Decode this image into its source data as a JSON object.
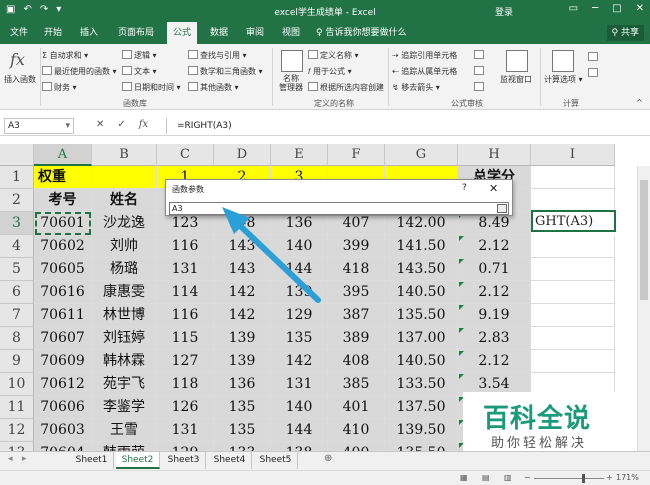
{
  "app": {
    "title": "excel学生成绩单 - Excel",
    "login": "登录",
    "share": "共享",
    "qat_icons": [
      "save-icon",
      "undo-icon",
      "redo-icon",
      "customize-icon"
    ],
    "window_buttons": [
      "minimize-icon",
      "maximize-icon",
      "close-icon"
    ]
  },
  "tabs": [
    {
      "label": "文件"
    },
    {
      "label": "开始"
    },
    {
      "label": "插入"
    },
    {
      "label": "页面布局"
    },
    {
      "label": "公式"
    },
    {
      "label": "数据"
    },
    {
      "label": "审阅"
    },
    {
      "label": "视图"
    }
  ],
  "tell_me": "♀ 告诉我你想要做什么",
  "ribbon": {
    "insert_function": "插入函数",
    "lib": {
      "autosum": "Σ 自动求和 ▾",
      "recent": "最近使用的函数 ▾",
      "financial": "财务 ▾",
      "logical": "逻辑 ▾",
      "text": "文本 ▾",
      "datetime": "日期和时间 ▾",
      "lookup": "查找与引用 ▾",
      "math": "数学和三角函数 ▾",
      "more": "其他函数 ▾",
      "group_label": "函数库"
    },
    "names": {
      "manager": "名称\n管理器",
      "define": "定义名称 ▾",
      "use_in_formula": "用于公式 ▾",
      "create": "根据所选内容创建",
      "group_label": "定义的名称"
    },
    "audit": {
      "trace_precedents": "追踪引用单元格",
      "trace_dependents": "追踪从属单元格",
      "remove_arrows": "移去箭头 ▾",
      "watch": "监视窗口",
      "group_label": "公式审核"
    },
    "calc": {
      "options": "计算选项 ▾",
      "group_label": "计算"
    }
  },
  "formula_bar": {
    "name_box": "A3",
    "formula": "=RIGHT(A3)",
    "icons": [
      "cancel-icon",
      "enter-icon",
      "fx-icon"
    ]
  },
  "columns": [
    "A",
    "B",
    "C",
    "D",
    "E",
    "F",
    "G",
    "H",
    "I"
  ],
  "rows": [
    "1",
    "2",
    "3",
    "4",
    "5",
    "6",
    "7",
    "8",
    "9",
    "10",
    "11",
    "12",
    "13"
  ],
  "row1": {
    "a": "权重",
    "c": "1",
    "d": "2",
    "e": "3",
    "h": "总学分"
  },
  "row2": {
    "a": "考号",
    "b": "姓名",
    "h": "绩点"
  },
  "data_rows": [
    {
      "id": "70601",
      "name": "沙龙逸",
      "c": "123",
      "d": "148",
      "e": "136",
      "f": "407",
      "g": "142.00",
      "h": "8.49"
    },
    {
      "id": "70602",
      "name": "刘帅",
      "c": "116",
      "d": "143",
      "e": "140",
      "f": "399",
      "g": "141.50",
      "h": "2.12"
    },
    {
      "id": "70605",
      "name": "杨璐",
      "c": "131",
      "d": "143",
      "e": "144",
      "f": "418",
      "g": "143.50",
      "h": "0.71"
    },
    {
      "id": "70616",
      "name": "康惠雯",
      "c": "114",
      "d": "142",
      "e": "139",
      "f": "395",
      "g": "140.50",
      "h": "2.12"
    },
    {
      "id": "70611",
      "name": "林世博",
      "c": "116",
      "d": "142",
      "e": "129",
      "f": "387",
      "g": "135.50",
      "h": "9.19"
    },
    {
      "id": "70607",
      "name": "刘钰婷",
      "c": "115",
      "d": "139",
      "e": "135",
      "f": "389",
      "g": "137.00",
      "h": "2.83"
    },
    {
      "id": "70609",
      "name": "韩林霖",
      "c": "127",
      "d": "139",
      "e": "142",
      "f": "408",
      "g": "140.50",
      "h": "2.12"
    },
    {
      "id": "70612",
      "name": "苑宇飞",
      "c": "118",
      "d": "136",
      "e": "131",
      "f": "385",
      "g": "133.50",
      "h": "3.54"
    },
    {
      "id": "70606",
      "name": "李鉴学",
      "c": "126",
      "d": "135",
      "e": "140",
      "f": "401",
      "g": "137.50",
      "h": ""
    },
    {
      "id": "70603",
      "name": "王雪",
      "c": "131",
      "d": "135",
      "e": "144",
      "f": "410",
      "g": "139.50",
      "h": ""
    },
    {
      "id": "70604",
      "name": "韩雨萌",
      "c": "129",
      "d": "133",
      "e": "138",
      "f": "400",
      "g": "135.50",
      "h": ""
    }
  ],
  "edit_cell_text": "GHT(A3)",
  "dialog": {
    "title": "函数参数",
    "help": "?",
    "close": "✕",
    "input_value": "A3"
  },
  "watermark": {
    "main": "百科全说",
    "sub": "助你轻松解决"
  },
  "sheets": [
    "Sheet1",
    "Sheet2",
    "Sheet3",
    "Sheet4",
    "Sheet5"
  ],
  "active_sheet": "Sheet2",
  "status": {
    "zoom": "171%"
  },
  "colors": {
    "excel_green": "#217346",
    "arrow_blue": "#2a9fd8",
    "header_yellow": "#ffff00"
  }
}
